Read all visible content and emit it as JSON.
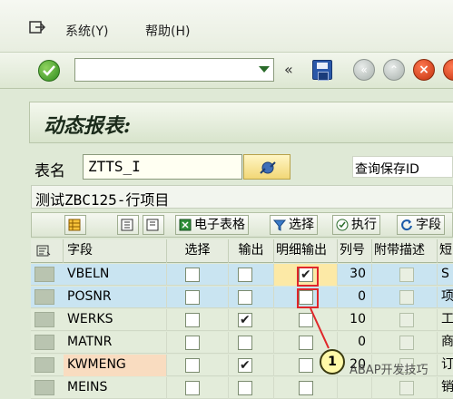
{
  "menu": {
    "system": "系统(Y)",
    "help": "帮助(H)"
  },
  "toolbar": {
    "command_value": "",
    "back_icon": "double-chevron-left-icon"
  },
  "page": {
    "title": "动态报表:"
  },
  "table_name": {
    "label": "表名",
    "value": "ZTTS_I",
    "variant_label": "查询保存ID"
  },
  "description": "测试ZBC125-行项目",
  "table_toolbar": {
    "spreadsheet": "电子表格",
    "select": "选择",
    "execute": "执行",
    "field": "字段"
  },
  "grid": {
    "headers": [
      "字段",
      "选择",
      "输出",
      "明细输出",
      "列号",
      "附带描述",
      "短"
    ],
    "rows": [
      {
        "field": "VBELN",
        "select": false,
        "output": false,
        "detail": true,
        "col": "30",
        "desc": "S"
      },
      {
        "field": "POSNR",
        "select": false,
        "output": false,
        "detail": false,
        "col": "0",
        "desc": "项"
      },
      {
        "field": "WERKS",
        "select": false,
        "output": true,
        "detail": false,
        "col": "10",
        "desc": "工"
      },
      {
        "field": "MATNR",
        "select": false,
        "output": false,
        "detail": false,
        "col": "0",
        "desc": "商"
      },
      {
        "field": "KWMENG",
        "select": false,
        "output": true,
        "detail": false,
        "col": "20",
        "desc": "订"
      },
      {
        "field": "MEINS",
        "select": false,
        "output": false,
        "detail": false,
        "col": "",
        "desc": "销"
      }
    ]
  },
  "annotation": {
    "callout": "1",
    "watermark": "ABAP开发技巧"
  },
  "colors": {
    "row_blue": "#c9e4f1",
    "row_orange": "#f9dcc0",
    "row_green": "#e3ecda",
    "highlight": "#e0262a"
  }
}
